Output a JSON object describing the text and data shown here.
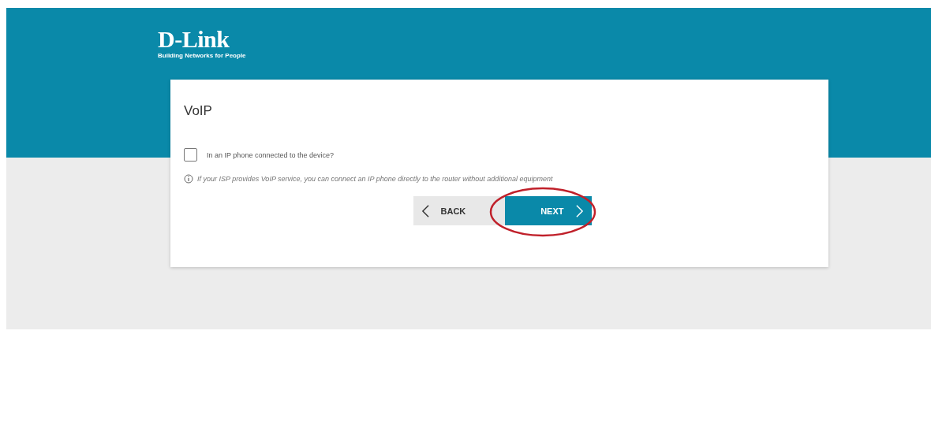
{
  "header": {
    "logo": "D-Link",
    "tagline": "Building Networks for People"
  },
  "card": {
    "title": "VoIP",
    "checkbox": {
      "label": "In an IP phone connected to the device?",
      "checked": false
    },
    "hint": "If your ISP provides VoIP service, you can connect an IP phone directly to the router without additional equipment",
    "buttons": [
      {
        "kind": "back",
        "label": "BACK",
        "highlighted": false
      },
      {
        "kind": "next",
        "label": "NEXT",
        "highlighted": true
      }
    ]
  }
}
